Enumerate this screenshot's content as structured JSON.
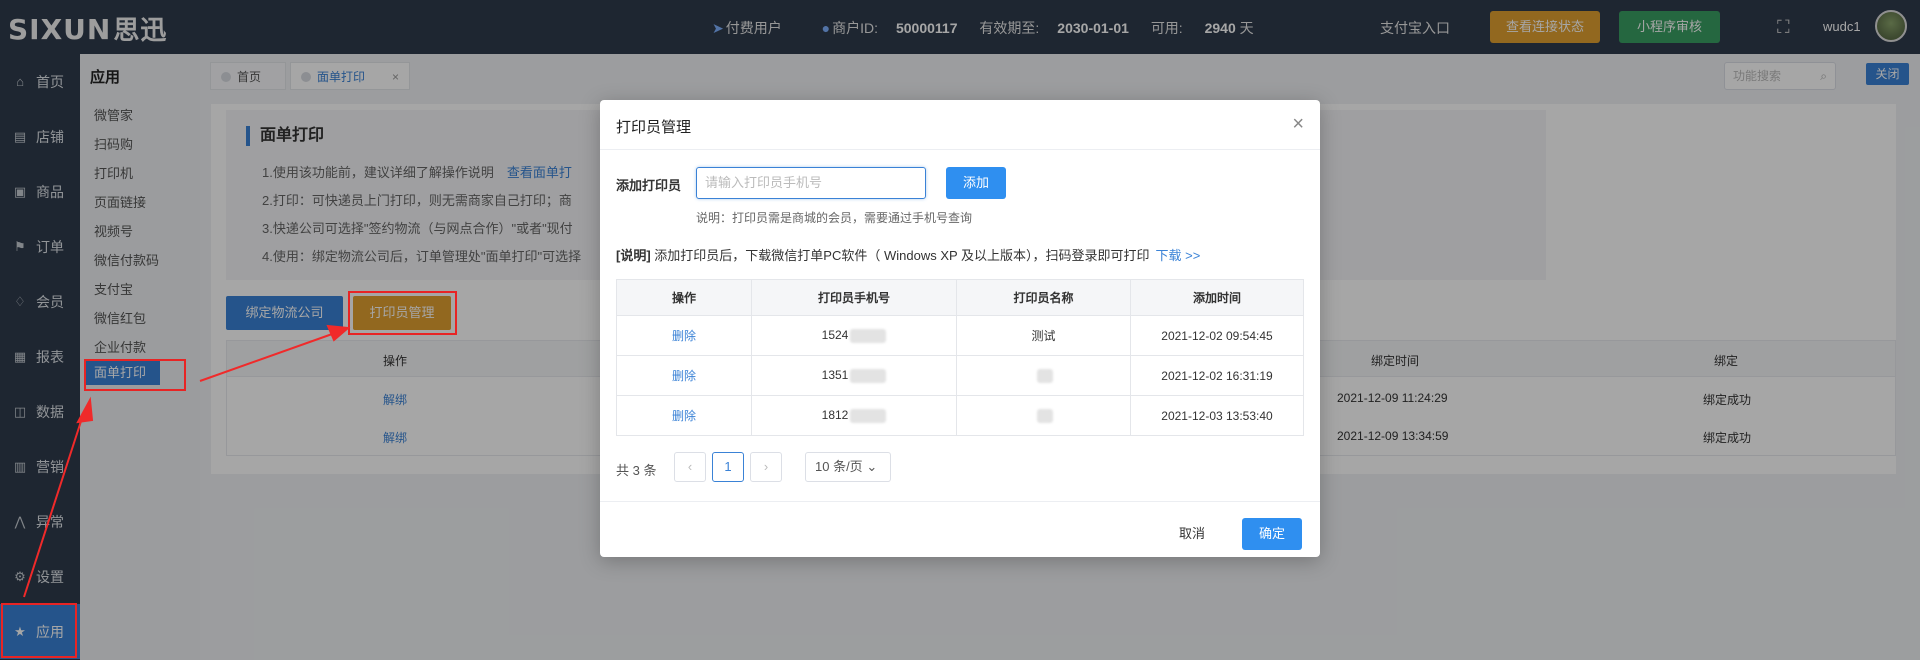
{
  "topbar": {
    "logo_latin": "SIXUN",
    "logo_cn": "思迅",
    "user_type": "付费用户",
    "merchant_label": "商户ID:",
    "merchant_id": "50000117",
    "valid_label": "有效期至:",
    "valid_date": "2030-01-01",
    "avail_label": "可用:",
    "avail_days": "2940",
    "avail_unit": "天",
    "alipay": "支付宝入口",
    "status_btn": "查看连接状态",
    "review_btn": "小程序审核",
    "username": "wudc1"
  },
  "leftnav": {
    "items": [
      {
        "label": "首页",
        "icon": "home-icon"
      },
      {
        "label": "店铺",
        "icon": "store-icon"
      },
      {
        "label": "商品",
        "icon": "gift-icon"
      },
      {
        "label": "订单",
        "icon": "order-icon"
      },
      {
        "label": "会员",
        "icon": "member-icon"
      },
      {
        "label": "报表",
        "icon": "report-icon"
      },
      {
        "label": "数据",
        "icon": "data-icon"
      },
      {
        "label": "营销",
        "icon": "marketing-icon"
      },
      {
        "label": "异常",
        "icon": "exception-icon"
      },
      {
        "label": "设置",
        "icon": "settings-icon"
      },
      {
        "label": "应用",
        "icon": "star-icon"
      }
    ]
  },
  "subnav": {
    "title": "应用",
    "items": [
      "微管家",
      "扫码购",
      "打印机",
      "页面链接",
      "视频号",
      "微信付款码",
      "支付宝",
      "微信红包",
      "企业付款",
      "面单打印"
    ]
  },
  "tabs": [
    {
      "label": "首页"
    },
    {
      "label": "面单打印"
    }
  ],
  "search": {
    "placeholder": "功能搜索"
  },
  "close_btn": "关闭",
  "notice": {
    "title": "面单打印",
    "line1": "1.使用该功能前，建议详细了解操作说明",
    "line1_link": "查看面单打",
    "line2": "2.打印：可快递员上门打印，则无需商家自己打印；商",
    "line3": "3.快递公司可选择\"签约物流（与网点合作）\"或者\"现付",
    "line4": "4.使用：绑定物流公司后，订单管理处\"面单打印\"可选择"
  },
  "actions": {
    "bind": "绑定物流公司",
    "printer": "打印员管理"
  },
  "bg_table": {
    "headers": {
      "op": "操作",
      "bind_time": "绑定时间",
      "bind": "绑定"
    },
    "rows": [
      {
        "op": "解绑",
        "bind_time": "2021-12-09 11:24:29",
        "bind": "绑定成功"
      },
      {
        "op": "解绑",
        "bind_time": "2021-12-09 13:34:59",
        "bind": "绑定成功"
      }
    ]
  },
  "modal": {
    "title": "打印员管理",
    "add_label": "添加打印员",
    "input_placeholder": "请输入打印员手机号",
    "add_btn": "添加",
    "hint": "说明：打印员需是商城的会员，需要通过手机号查询",
    "note_prefix": "[说明]",
    "note_text": "添加打印员后，下载微信打单PC软件（ Windows XP 及以上版本），扫码登录即可打印",
    "note_link": "下载 >>",
    "table": {
      "headers": [
        "操作",
        "打印员手机号",
        "打印员名称",
        "添加时间"
      ],
      "rows": [
        {
          "op": "删除",
          "phone": "1524",
          "name": "测试",
          "time": "2021-12-02 09:54:45"
        },
        {
          "op": "删除",
          "phone": "1351",
          "name": "",
          "time": "2021-12-02 16:31:19"
        },
        {
          "op": "删除",
          "phone": "1812",
          "name": "",
          "time": "2021-12-03 13:53:40"
        }
      ]
    },
    "total": "共 3 条",
    "page": "1",
    "page_size": "10 条/页",
    "cancel": "取消",
    "ok": "确定"
  }
}
